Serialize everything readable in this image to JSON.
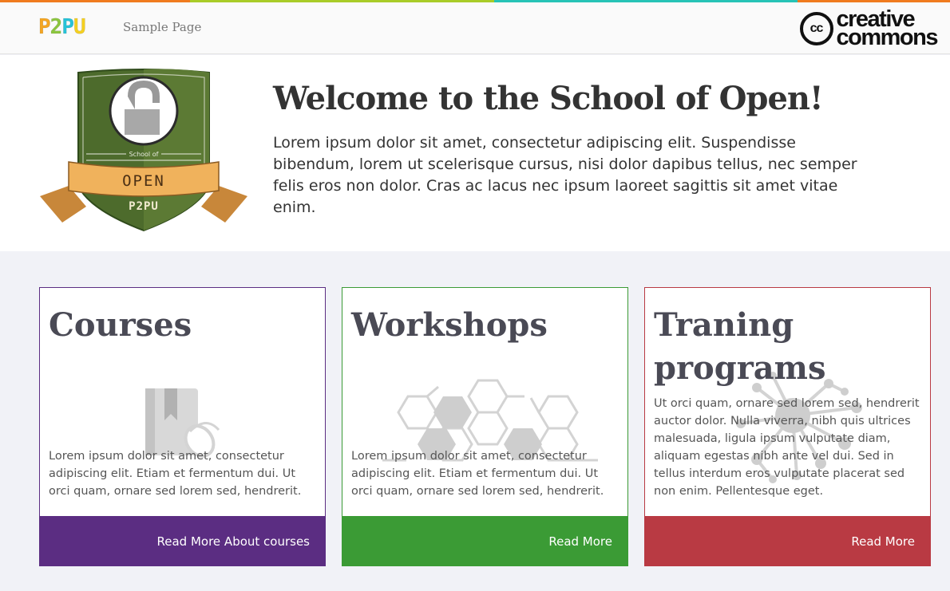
{
  "colors": {
    "strip": [
      "#f07b1f",
      "#a9cc28",
      "#27c3b6",
      "#f07b1f"
    ],
    "logo_letters": [
      "#f5a623",
      "#8cc63f",
      "#27c3d8",
      "#f5d020"
    ],
    "courses": "#5b2d82",
    "workshops": "#3b9b35",
    "training": "#b93a43",
    "badge_shield": "#4d6b2c",
    "badge_ribbon": "#f0b25c"
  },
  "navbar": {
    "logo_letters": [
      "P",
      "2",
      "P",
      "U"
    ],
    "sample_page": "Sample Page",
    "cc_mark": "cc",
    "cc_word1": "creative",
    "cc_word2": "commons"
  },
  "badge": {
    "school_of": "School of",
    "open": "OPEN",
    "p2pu": "P2PU",
    "icon": "open-padlock-icon"
  },
  "hero": {
    "title": "Welcome to the School of Open!",
    "text": "Lorem ipsum dolor sit amet, consectetur adipiscing elit. Suspendisse bibendum, lorem ut scelerisque cursus, nisi dolor dapibus tellus, nec semper felis eros non dolor. Cras ac lacus nec ipsum laoreet sagittis sit amet vitae enim."
  },
  "cards": [
    {
      "title": "Courses",
      "icon": "book-mouse-icon",
      "body": "Lorem ipsum dolor sit amet, consectetur adipiscing elit. Etiam et fermentum dui. Ut orci quam, ornare sed lorem sed, hendrerit.",
      "link": "Read More About courses"
    },
    {
      "title": "Workshops",
      "icon": "hexagon-network-icon",
      "body": "Lorem ipsum dolor sit amet, consectetur adipiscing elit. Etiam et fermentum dui. Ut orci quam, ornare sed lorem sed, hendrerit.",
      "link": "Read More"
    },
    {
      "title": "Traning programs",
      "icon": "molecule-network-icon",
      "body": "Ut orci quam, ornare sed lorem sed, hendrerit auctor dolor. Nulla viverra, nibh quis ultrices malesuada, ligula ipsum vulputate diam, aliquam egestas nibh ante vel dui. Sed in tellus interdum eros vulputate placerat sed non enim. Pellentesque eget.",
      "link": "Read More"
    }
  ]
}
